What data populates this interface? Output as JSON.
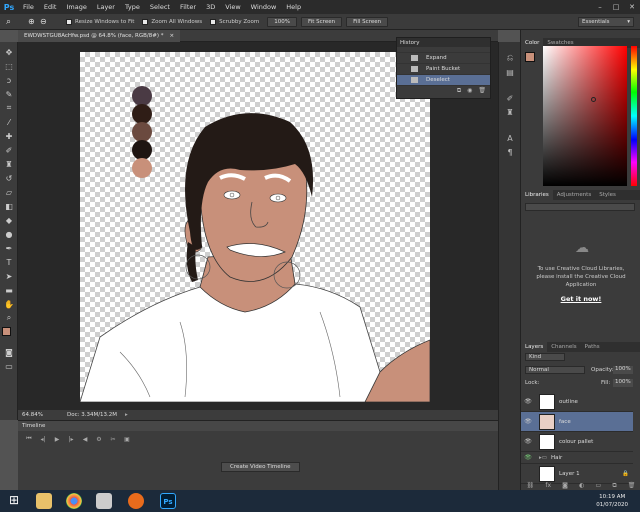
{
  "app": {
    "logo": "Ps"
  },
  "menu": [
    "File",
    "Edit",
    "Image",
    "Layer",
    "Type",
    "Select",
    "Filter",
    "3D",
    "View",
    "Window",
    "Help"
  ],
  "options_bar": {
    "resize_windows": "Resize Windows to Fit",
    "zoom_all": "Zoom All Windows",
    "scrubby_zoom": "Scrubby Zoom",
    "btn_100": "100%",
    "fit_screen": "Fit Screen",
    "fill_screen": "Fill Screen",
    "workspace": "Essentials"
  },
  "document": {
    "tab_title": "EWDWSTGU8AcHfw.psd @ 64.8% (face, RGB/8#) *"
  },
  "status": {
    "zoom": "64.84%",
    "doc": "Doc: 3.34M/13.2M"
  },
  "timeline": {
    "title": "Timeline",
    "create_button": "Create Video Timeline"
  },
  "history": {
    "title": "History",
    "items": [
      {
        "label": "Expand",
        "selected": false
      },
      {
        "label": "Paint Bucket",
        "selected": false
      },
      {
        "label": "Deselect",
        "selected": true
      }
    ]
  },
  "color_panel": {
    "tabs": [
      "Color",
      "Swatches"
    ],
    "foreground": "#c8907a"
  },
  "libraries": {
    "tabs": [
      "Libraries",
      "Adjustments",
      "Styles"
    ],
    "message": "To use Creative Cloud Libraries, please install the Creative Cloud Application",
    "cta": "Get it now!"
  },
  "layers": {
    "tabs": [
      "Layers",
      "Channels",
      "Paths"
    ],
    "kind": "Kind",
    "blend": "Normal",
    "opacity_label": "Opacity:",
    "opacity": "100%",
    "lock_label": "Lock:",
    "fill_label": "Fill:",
    "fill": "100%",
    "items": [
      {
        "name": "outline",
        "selected": false
      },
      {
        "name": "face",
        "selected": true
      },
      {
        "name": "colour pallet",
        "selected": false
      },
      {
        "name": "Hair",
        "selected": false
      },
      {
        "name": "Layer 1",
        "selected": false
      }
    ]
  },
  "palette_colors": [
    "#4a3a44",
    "#2f1d16",
    "#6b4a3f",
    "#1e1512",
    "#c8907a"
  ],
  "taskbar": {
    "time": "10:19 AM",
    "date": "01/07/2020"
  }
}
